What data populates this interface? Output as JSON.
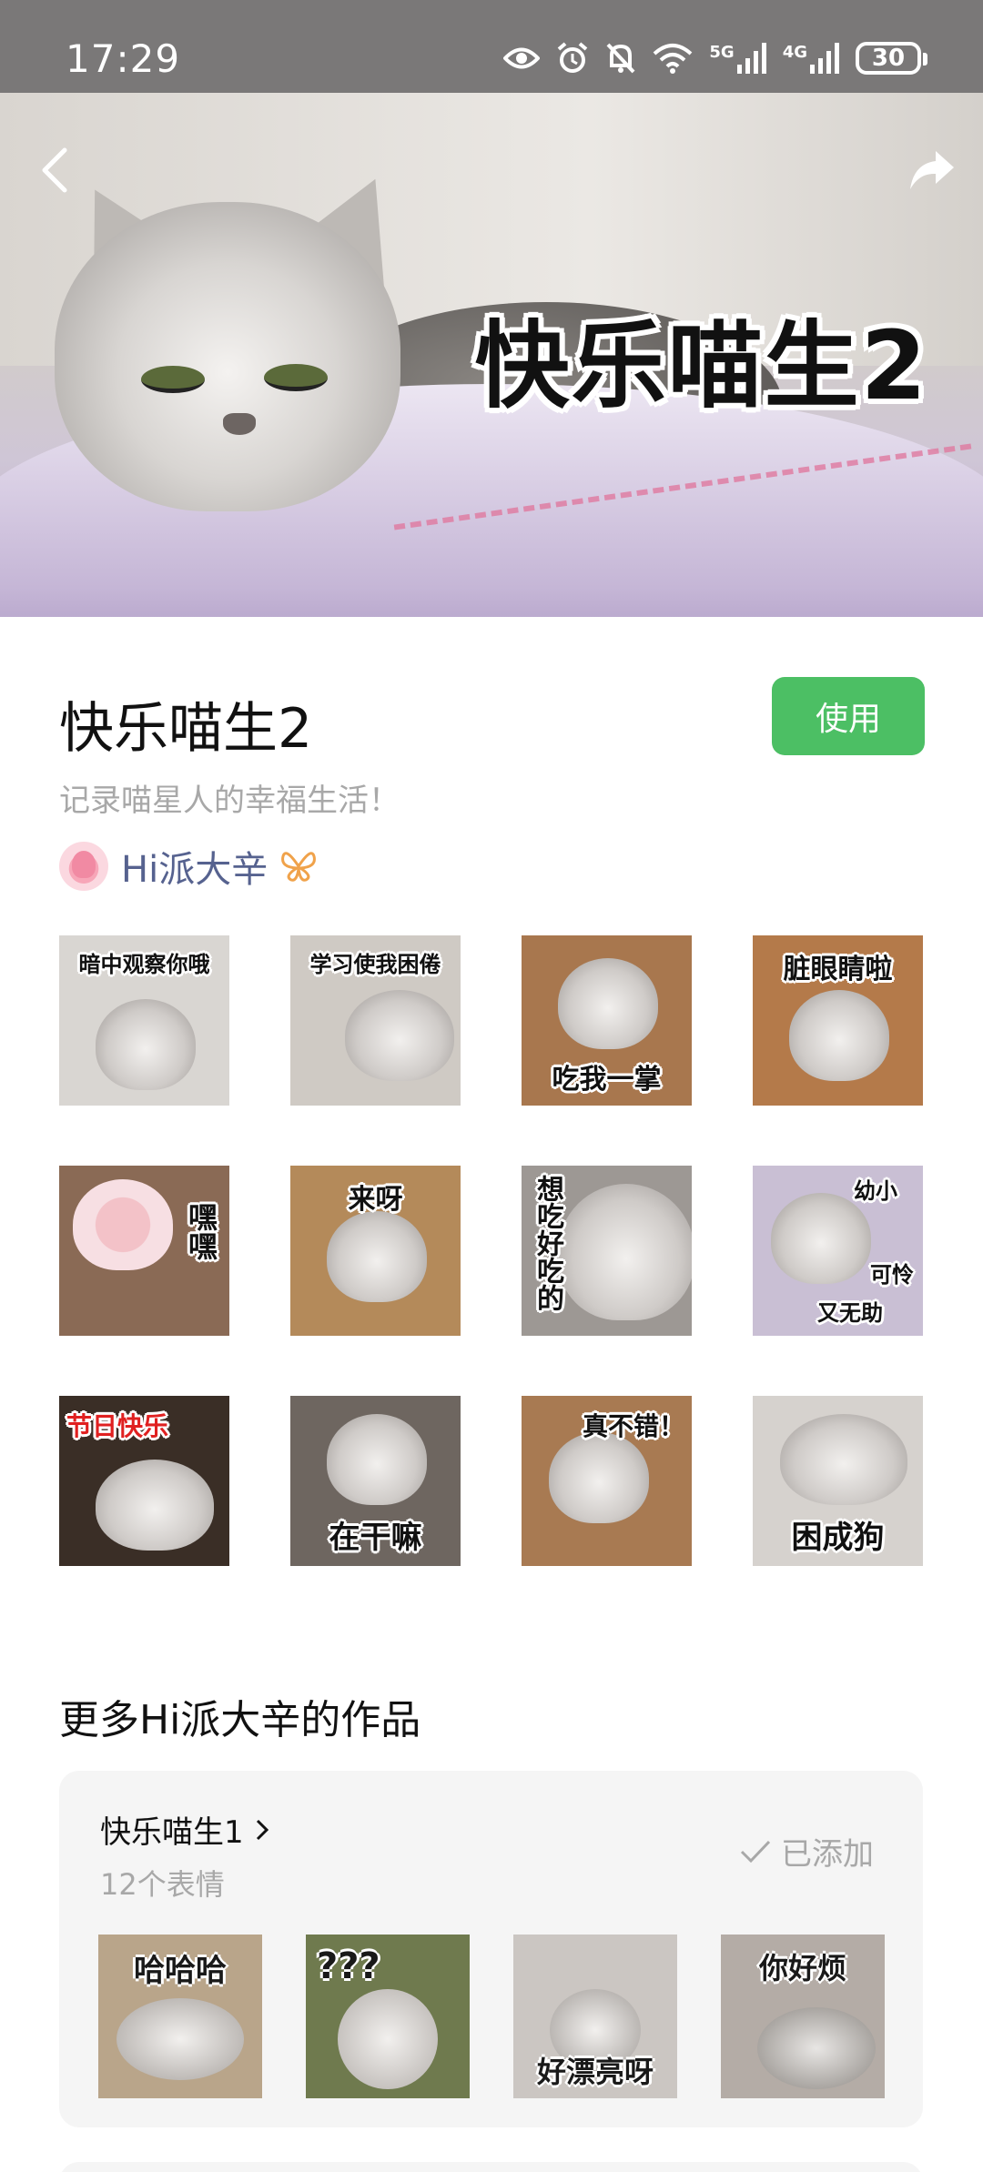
{
  "status_bar": {
    "time": "17:29",
    "battery": "30",
    "network_1": "5G",
    "network_2": "4G",
    "icons": [
      "eye-icon",
      "alarm-icon",
      "mute-icon",
      "wifi-icon",
      "signal-5g-icon",
      "signal-4g-icon",
      "battery-icon"
    ]
  },
  "banner": {
    "title": "快乐喵生2",
    "back_icon": "chevron-left-icon",
    "share_icon": "share-arrow-icon"
  },
  "pack": {
    "name": "快乐喵生2",
    "use_button": "使用",
    "description": "记录喵星人的幸福生活！",
    "author": "Hi派大辛",
    "author_badge_icon": "butterfly-badge-icon",
    "accent_color": "#4cbf64",
    "author_color": "#56628f"
  },
  "stickers": [
    {
      "caption": "暗中观察你哦",
      "bg": "#d9d6d2"
    },
    {
      "caption": "学习使我困倦",
      "bg": "#cfcac4"
    },
    {
      "caption": "吃我一掌",
      "bg": "#a8774e"
    },
    {
      "caption": "脏眼睛啦",
      "bg": "#b47a4a"
    },
    {
      "caption": "嘿嘿",
      "bg": "#8a6a55"
    },
    {
      "caption": "来呀",
      "bg": "#b48a5a"
    },
    {
      "caption": "想吃好吃的",
      "bg": "#9d9894"
    },
    {
      "caption_1": "幼小",
      "caption_2": "可怜",
      "caption_3": "又无助",
      "bg": "#c9bfd4"
    },
    {
      "caption": "节日快乐",
      "bg": "#3a2e26"
    },
    {
      "caption": "在干嘛",
      "bg": "#6e6660"
    },
    {
      "caption": "真不错！",
      "bg": "#a87a52"
    },
    {
      "caption": "困成狗",
      "bg": "#d6d2ce"
    }
  ],
  "more": {
    "title": "更多Hi派大辛的作品",
    "item": {
      "name": "快乐喵生1",
      "count": "12个表情",
      "status": "已添加",
      "thumbs": [
        {
          "caption": "哈哈哈",
          "bg": "#b9a58a"
        },
        {
          "caption": "???",
          "bg": "#6f7a4e"
        },
        {
          "caption": "好漂亮呀",
          "bg": "#cbc6c2"
        },
        {
          "caption": "你好烦",
          "bg": "#b4aca6"
        }
      ]
    }
  }
}
